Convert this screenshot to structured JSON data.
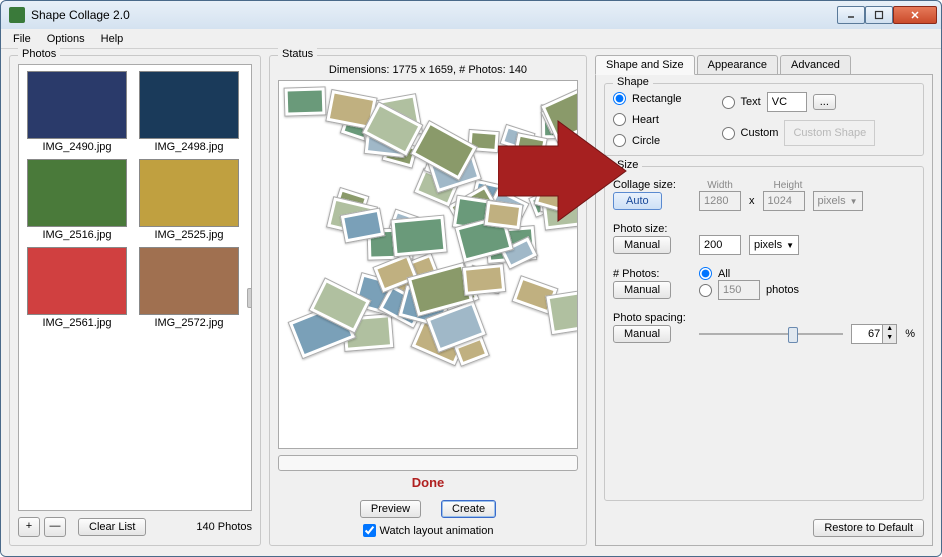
{
  "window": {
    "title": "Shape Collage 2.0"
  },
  "menu": {
    "file": "File",
    "options": "Options",
    "help": "Help"
  },
  "photos": {
    "legend": "Photos",
    "items": [
      {
        "name": "IMG_2490.jpg",
        "bg": "#2a3a6a"
      },
      {
        "name": "IMG_2498.jpg",
        "bg": "#1a3a5a"
      },
      {
        "name": "IMG_2516.jpg",
        "bg": "#4a7a3a"
      },
      {
        "name": "IMG_2525.jpg",
        "bg": "#c0a040"
      },
      {
        "name": "IMG_2561.jpg",
        "bg": "#d04040"
      },
      {
        "name": "IMG_2572.jpg",
        "bg": "#a07050"
      }
    ],
    "add": "+",
    "remove": "—",
    "clear": "Clear List",
    "count": "140 Photos"
  },
  "status": {
    "legend": "Status",
    "dims": "Dimensions: 1775 x 1659, # Photos: 140",
    "done": "Done",
    "preview": "Preview",
    "create": "Create",
    "watch": "Watch layout animation"
  },
  "tabs": {
    "shape": "Shape and Size",
    "appearance": "Appearance",
    "advanced": "Advanced"
  },
  "shape": {
    "legend": "Shape",
    "rectangle": "Rectangle",
    "heart": "Heart",
    "circle": "Circle",
    "text": "Text",
    "text_value": "VC",
    "text_browse": "...",
    "custom": "Custom",
    "custom_box": "Custom Shape"
  },
  "size": {
    "legend": "Size",
    "collage_label": "Collage size:",
    "auto": "Auto",
    "width_label": "Width",
    "width": "1280",
    "x": "x",
    "height_label": "Height",
    "height": "1024",
    "unit_px": "pixels",
    "photo_label": "Photo size:",
    "manual": "Manual",
    "photo_size": "200",
    "nphotos_label": "# Photos:",
    "all": "All",
    "nphotos": "150",
    "photos_suffix": "photos",
    "spacing_label": "Photo spacing:",
    "spacing": "67",
    "pct": "%"
  },
  "restore": "Restore to Default"
}
